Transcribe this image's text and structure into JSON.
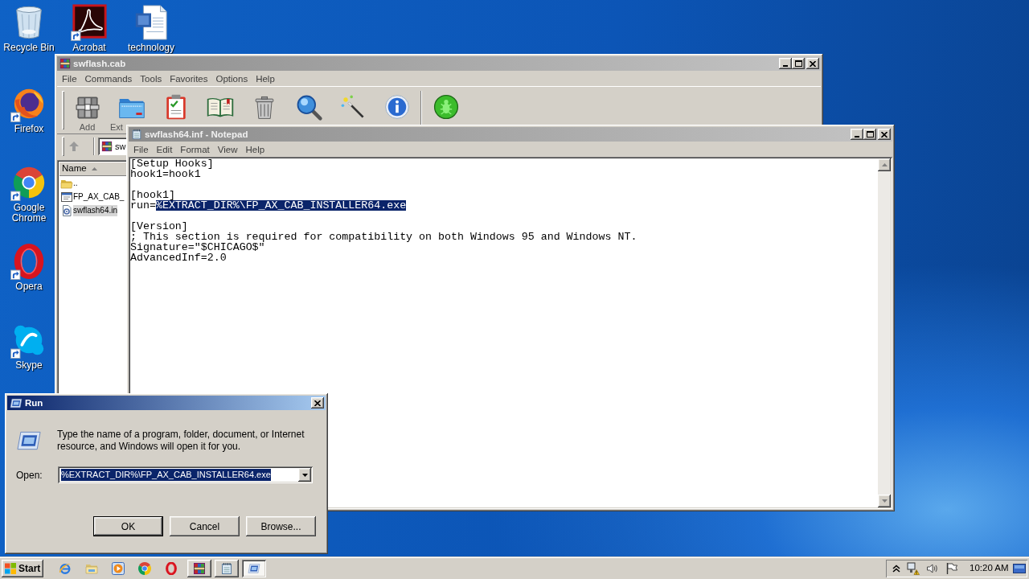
{
  "desktop": {
    "icons": [
      {
        "label": "Recycle Bin",
        "kind": "recycle-bin",
        "shortcut": false
      },
      {
        "label": "Acrobat",
        "kind": "pdf",
        "shortcut": true
      },
      {
        "label": "technology",
        "kind": "word-document",
        "shortcut": false
      },
      {
        "label": "Firefox",
        "kind": "firefox",
        "shortcut": true
      },
      {
        "label": "Google Chrome",
        "kind": "chrome",
        "shortcut": true
      },
      {
        "label": "Opera",
        "kind": "opera",
        "shortcut": true
      },
      {
        "label": "Skype",
        "kind": "skype",
        "shortcut": true
      }
    ]
  },
  "winrar_window": {
    "title": "swflash.cab",
    "active": false,
    "menu": [
      "File",
      "Commands",
      "Tools",
      "Favorites",
      "Options",
      "Help"
    ],
    "toolbar": [
      {
        "kind": "add",
        "label": "Add"
      },
      {
        "kind": "extract",
        "label": "Ext"
      },
      {
        "kind": "test"
      },
      {
        "kind": "view"
      },
      {
        "kind": "delete"
      },
      {
        "kind": "find"
      },
      {
        "kind": "wizard"
      },
      {
        "kind": "info"
      },
      {
        "kind": "separator"
      },
      {
        "kind": "virus-scan"
      }
    ],
    "address": "sw",
    "columns": [
      {
        "label": "Name",
        "sorted": true
      }
    ],
    "files": [
      {
        "name": "..",
        "kind": "parent",
        "selected": false
      },
      {
        "name": "FP_AX_CAB_",
        "kind": "executable",
        "selected": false
      },
      {
        "name": "swflash64.in",
        "kind": "settings",
        "selected": true
      }
    ]
  },
  "notepad_window": {
    "title": "swflash64.inf - Notepad",
    "active": false,
    "menu": [
      "File",
      "Edit",
      "Format",
      "View",
      "Help"
    ],
    "paragraphs": [
      [
        {
          "text": "[Setup Hooks]"
        },
        {
          "text": "hook1=hook1"
        }
      ],
      [
        {
          "text": "[hook1]"
        },
        {
          "text": "run=",
          "selection": "%EXTRACT_DIR%\\FP_AX_CAB_INSTALLER64.exe"
        }
      ],
      [
        {
          "text": "[Version]"
        },
        {
          "text": "; This section is required for compatibility on both Windows 95 and Windows NT."
        },
        {
          "text": "Signature=\"$CHICAGO$\""
        },
        {
          "text": "AdvancedInf=2.0"
        }
      ]
    ]
  },
  "run_dialog": {
    "title": "Run",
    "active": true,
    "description": "Type the name of a program, folder, document, or Internet resource, and Windows will open it for you.",
    "open_label": "Open:",
    "open_value": "%EXTRACT_DIR%\\FP_AX_CAB_INSTALLER64.exe",
    "value_selected": true,
    "buttons": [
      {
        "label": "OK",
        "default": true
      },
      {
        "label": "Cancel",
        "default": false
      },
      {
        "label": "Browse...",
        "default": false
      }
    ]
  },
  "taskbar": {
    "start_label": "Start",
    "quick_launch": [
      {
        "kind": "internet-explorer"
      },
      {
        "kind": "explorer"
      },
      {
        "kind": "media-player"
      },
      {
        "kind": "chrome"
      },
      {
        "kind": "opera"
      }
    ],
    "tasks": [
      {
        "kind": "winrar",
        "selected": false
      },
      {
        "kind": "notepad",
        "selected": false
      },
      {
        "kind": "run",
        "selected": true
      }
    ],
    "tray": [
      {
        "kind": "show-hidden"
      },
      {
        "kind": "network-warning"
      },
      {
        "kind": "volume"
      },
      {
        "kind": "action-center"
      }
    ],
    "clock": "10:20 AM"
  }
}
